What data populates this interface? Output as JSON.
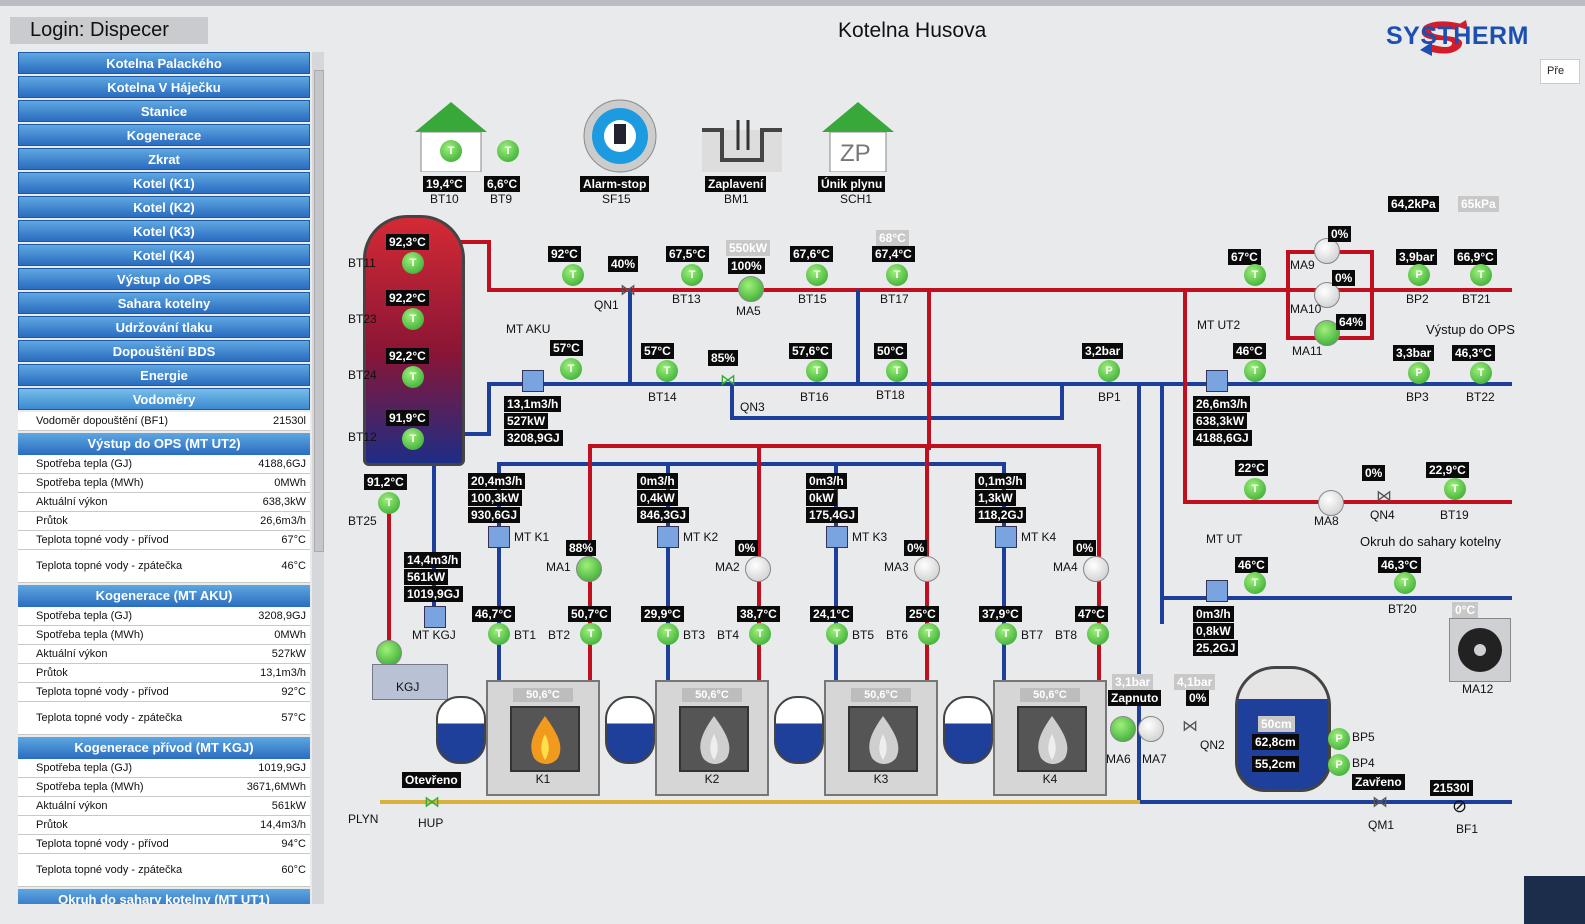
{
  "header": {
    "login": "Login: Dispecer",
    "title": "Kotelna Husova",
    "brand": "SYSTHERM",
    "pre_label": "Pře"
  },
  "nav": [
    "Kotelna Palackého",
    "Kotelna V Háječku",
    "Stanice",
    "Kogenerace",
    "Zkrat",
    "Kotel (K1)",
    "Kotel (K2)",
    "Kotel (K3)",
    "Kotel (K4)",
    "Výstup do OPS",
    "Sahara kotelny",
    "Udržování tlaku",
    "Dopouštění BDS",
    "Energie",
    "Vodoměry"
  ],
  "water_meter": {
    "label": "Vodoměr dopouštění (BF1)",
    "value": "21530l"
  },
  "sections": [
    {
      "title": "Výstup do OPS (MT UT2)",
      "rows": [
        {
          "label": "Spotřeba tepla (GJ)",
          "value": "4188,6GJ"
        },
        {
          "label": "Spotřeba tepla (MWh)",
          "value": "0MWh"
        },
        {
          "label": "Aktuální výkon",
          "value": "638,3kW"
        },
        {
          "label": "Průtok",
          "value": "26,6m3/h"
        },
        {
          "label": "Teplota topné vody - přívod",
          "value": "67°C"
        },
        {
          "label": "Teplota topné vody - zpátečka",
          "value": "46°C"
        }
      ]
    },
    {
      "title": "Kogenerace (MT AKU)",
      "rows": [
        {
          "label": "Spotřeba tepla (GJ)",
          "value": "3208,9GJ"
        },
        {
          "label": "Spotřeba tepla (MWh)",
          "value": "0MWh"
        },
        {
          "label": "Aktuální výkon",
          "value": "527kW"
        },
        {
          "label": "Průtok",
          "value": "13,1m3/h"
        },
        {
          "label": "Teplota topné vody - přívod",
          "value": "92°C"
        },
        {
          "label": "Teplota topné vody - zpátečka",
          "value": "57°C"
        }
      ]
    },
    {
      "title": "Kogenerace přívod (MT KGJ)",
      "rows": [
        {
          "label": "Spotřeba tepla (GJ)",
          "value": "1019,9GJ"
        },
        {
          "label": "Spotřeba tepla (MWh)",
          "value": "3671,6MWh"
        },
        {
          "label": "Aktuální výkon",
          "value": "561kW"
        },
        {
          "label": "Průtok",
          "value": "14,4m3/h"
        },
        {
          "label": "Teplota topné vody - přívod",
          "value": "94°C"
        },
        {
          "label": "Teplota topné vody - zpátečka",
          "value": "60°C"
        }
      ]
    }
  ],
  "section_cut": "Okruh do sahary kotelny (MT UT1)",
  "diagram": {
    "bt10": "19,4°C",
    "bt9": "6,6°C",
    "bt10_lbl": "BT10",
    "bt9_lbl": "BT9",
    "alarm": "Alarm-stop",
    "sf15": "SF15",
    "flood": "Zaplavení",
    "bm1": "BM1",
    "gas": "Únik plynu",
    "sch1": "SCH1",
    "zp": "ZP",
    "p_top": "64,2kPa",
    "p_top2": "65kPa",
    "tank_temps": [
      "92,3°C",
      "92,2°C",
      "92,2°C",
      "91,9°C"
    ],
    "tank_lbls": [
      "BT11",
      "BT23",
      "BT24",
      "BT12"
    ],
    "bt25": "91,2°C",
    "bt25_lbl": "BT25",
    "qn1_lbl": "QN1",
    "qn1_val": "40%",
    "t92": "92°C",
    "bt13": "67,5°C",
    "bt13_lbl": "BT13",
    "ma5_kw": "550kW",
    "ma5_pct": "100%",
    "ma5_lbl": "MA5",
    "bt15": "67,6°C",
    "bt15_lbl": "BT15",
    "bt17_grey": "68°C",
    "bt17": "67,4°C",
    "bt17_lbl": "BT17",
    "mt_aku": "MT AKU",
    "aku_vals": [
      "13,1m3/h",
      "527kW",
      "3208,9GJ"
    ],
    "t57": "57°C",
    "bt14": "57°C",
    "bt14_lbl": "BT14",
    "qn3": "85%",
    "qn3_lbl": "QN3",
    "bt16": "57,6°C",
    "bt16_lbl": "BT16",
    "bt18": "50°C",
    "bt18_lbl": "BT18",
    "bp1": "3,2bar",
    "bp1_lbl": "BP1",
    "bt_ut2": "67°C",
    "ma9_lbl": "MA9",
    "ma9": "0%",
    "ma10_lbl": "MA10",
    "ma10": "0%",
    "ma11_lbl": "MA11",
    "ma11": "64%",
    "bp2": "3,9bar",
    "bp2_lbl": "BP2",
    "bt21": "66,9°C",
    "bt21_lbl": "BT21",
    "ops": "Výstup do OPS",
    "mt_ut2": "MT UT2",
    "ut2_t": "46°C",
    "ut2_vals": [
      "26,6m3/h",
      "638,3kW",
      "4188,6GJ"
    ],
    "bp3": "3,3bar",
    "bp3_lbl": "BP3",
    "bt22": "46,3°C",
    "bt22_lbl": "BT22",
    "mt_kgj": "MT KGJ",
    "kgj_vals": [
      "14,4m3/h",
      "561kW",
      "1019,9GJ"
    ],
    "kgj": "KGJ",
    "boilers": [
      {
        "vals": [
          "20,4m3/h",
          "100,3kW",
          "930,6GJ"
        ],
        "mt": "MT K1",
        "pump": "88%",
        "ma": "MA1",
        "t1": "46,7°C",
        "t1l": "BT1",
        "t2": "50,7°C",
        "t2l": "BT2",
        "temp": "50,6°C",
        "name": "K1"
      },
      {
        "vals": [
          "0m3/h",
          "0,4kW",
          "846,3GJ"
        ],
        "mt": "MT K2",
        "pump": "0%",
        "ma": "MA2",
        "t1": "29,9°C",
        "t1l": "BT3",
        "t2": "38,7°C",
        "t2l": "BT4",
        "temp": "50,6°C",
        "name": "K2"
      },
      {
        "vals": [
          "0m3/h",
          "0kW",
          "175,4GJ"
        ],
        "mt": "MT K3",
        "pump": "0%",
        "ma": "MA3",
        "t1": "24,1°C",
        "t1l": "BT5",
        "t2": "25°C",
        "t2l": "BT6",
        "temp": "50,6°C",
        "name": "K3"
      },
      {
        "vals": [
          "0,1m3/h",
          "1,3kW",
          "118,2GJ"
        ],
        "mt": "MT K4",
        "pump": "0%",
        "ma": "MA4",
        "t1": "37,9°C",
        "t1l": "BT7",
        "t2": "47°C",
        "t2l": "BT8",
        "temp": "50,6°C",
        "name": "K4"
      }
    ],
    "bt_ut": "22°C",
    "ma8_lbl": "MA8",
    "qn4": "0%",
    "qn4_lbl": "QN4",
    "bt19": "22,9°C",
    "bt19_lbl": "BT19",
    "okruh": "Okruh do sahary kotelny",
    "mt_ut": "MT UT",
    "ut_t": "46°C",
    "ut_vals": [
      "0m3/h",
      "0,8kW",
      "25,2GJ"
    ],
    "bt20": "46,3°C",
    "bt20_lbl": "BT20",
    "ma12_t": "0°C",
    "ma12_lbl": "MA12",
    "p31": "3,1bar",
    "p41": "4,1bar",
    "zapnuto": "Zapnuto",
    "ma6_pct": "0%",
    "ma6_lbl": "MA6",
    "ma7_lbl": "MA7",
    "qn2_lbl": "QN2",
    "aku_top": "50cm",
    "aku_mid": "62,8cm",
    "aku_bot": "55,2cm",
    "bp5_lbl": "BP5",
    "bp4_lbl": "BP4",
    "zavreno": "Zavřeno",
    "qm1_lbl": "QM1",
    "bf1_val": "21530l",
    "bf1_lbl": "BF1",
    "otevreno": "Otevřeno",
    "hup": "HUP",
    "plyn": "PLYN"
  },
  "colors": {
    "supply": "#c0101f",
    "return": "#1d3f9a",
    "gas": "#d8b23a",
    "nav": "#2a6cc0"
  }
}
